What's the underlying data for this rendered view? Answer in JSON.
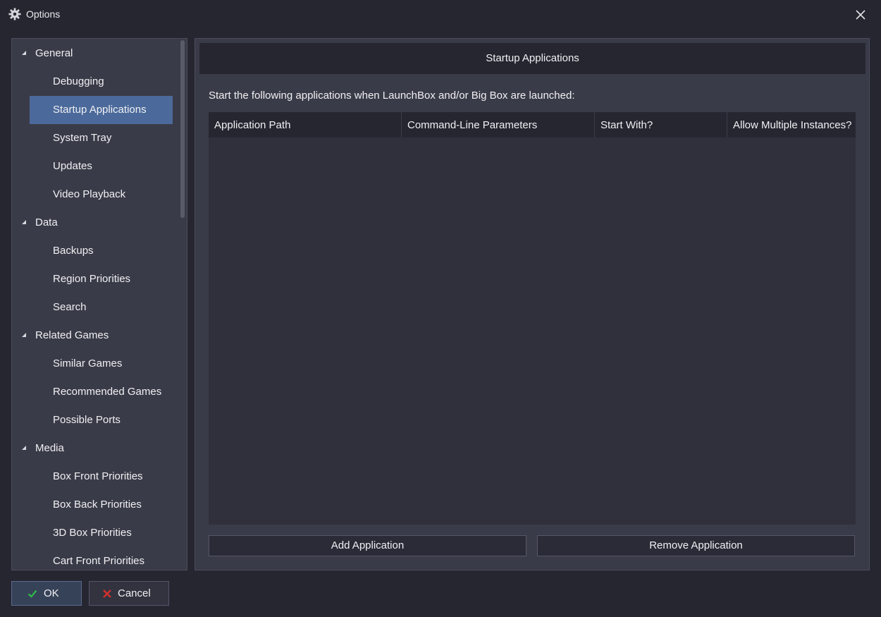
{
  "window": {
    "title": "Options",
    "title_icon": "gear-icon",
    "close_icon": "close-icon"
  },
  "sidebar": {
    "items": [
      {
        "label": "General",
        "type": "group",
        "expanded": true
      },
      {
        "label": "Debugging",
        "type": "child"
      },
      {
        "label": "Startup Applications",
        "type": "child",
        "selected": true
      },
      {
        "label": "System Tray",
        "type": "child"
      },
      {
        "label": "Updates",
        "type": "child"
      },
      {
        "label": "Video Playback",
        "type": "child"
      },
      {
        "label": "Data",
        "type": "group",
        "expanded": true
      },
      {
        "label": "Backups",
        "type": "child"
      },
      {
        "label": "Region Priorities",
        "type": "child"
      },
      {
        "label": "Search",
        "type": "child"
      },
      {
        "label": "Related Games",
        "type": "group",
        "expanded": true
      },
      {
        "label": "Similar Games",
        "type": "child"
      },
      {
        "label": "Recommended Games",
        "type": "child"
      },
      {
        "label": "Possible Ports",
        "type": "child"
      },
      {
        "label": "Media",
        "type": "group",
        "expanded": true
      },
      {
        "label": "Box Front Priorities",
        "type": "child"
      },
      {
        "label": "Box Back Priorities",
        "type": "child"
      },
      {
        "label": "3D Box Priorities",
        "type": "child"
      },
      {
        "label": "Cart Front Priorities",
        "type": "child"
      }
    ]
  },
  "main": {
    "header": "Startup Applications",
    "description": "Start the following applications when LaunchBox and/or Big Box are launched:",
    "table": {
      "columns": [
        "Application Path",
        "Command-Line Parameters",
        "Start With?",
        "Allow Multiple Instances?"
      ],
      "rows": []
    },
    "add_label": "Add Application",
    "remove_label": "Remove Application"
  },
  "footer": {
    "ok_label": "OK",
    "ok_icon": "checkmark-icon",
    "cancel_label": "Cancel",
    "cancel_icon": "x-mark-icon"
  },
  "colors": {
    "background": "#262631",
    "panel": "#3a3b48",
    "selected": "#4b6a9b",
    "ok_check": "#2fb84a",
    "cancel_x": "#d0312d"
  }
}
